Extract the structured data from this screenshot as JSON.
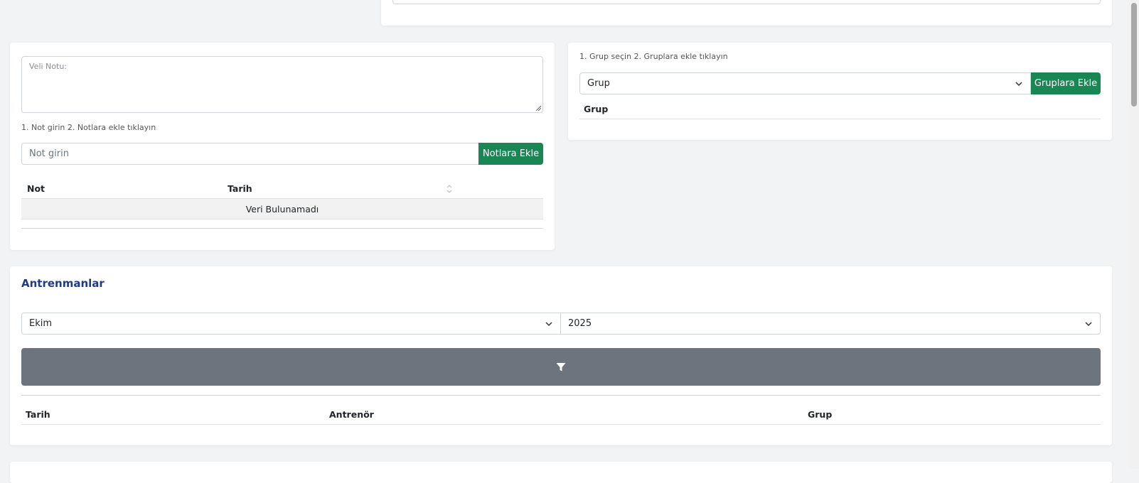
{
  "notes": {
    "textarea_label": "Veli Notu:",
    "hint": "1. Not girin 2. Notlara ekle tıklayın",
    "input_placeholder": "Not girin",
    "add_button": "Notlara Ekle",
    "columns": [
      "Not",
      "Tarih"
    ],
    "empty_text": "Veri Bulunamadı"
  },
  "groups": {
    "hint": "1. Grup seçin 2. Gruplara ekle tıklayın",
    "select_value": "Grup",
    "add_button": "Gruplara Ekle",
    "column": "Grup"
  },
  "trainings": {
    "title": "Antrenmanlar",
    "month_value": "Ekim",
    "year_value": "2025",
    "columns": [
      "Tarih",
      "Antrenör",
      "Grup"
    ]
  },
  "colors": {
    "accent_green": "#198754",
    "filter_bar": "#6c757d",
    "title_blue": "#1e3a8a"
  }
}
